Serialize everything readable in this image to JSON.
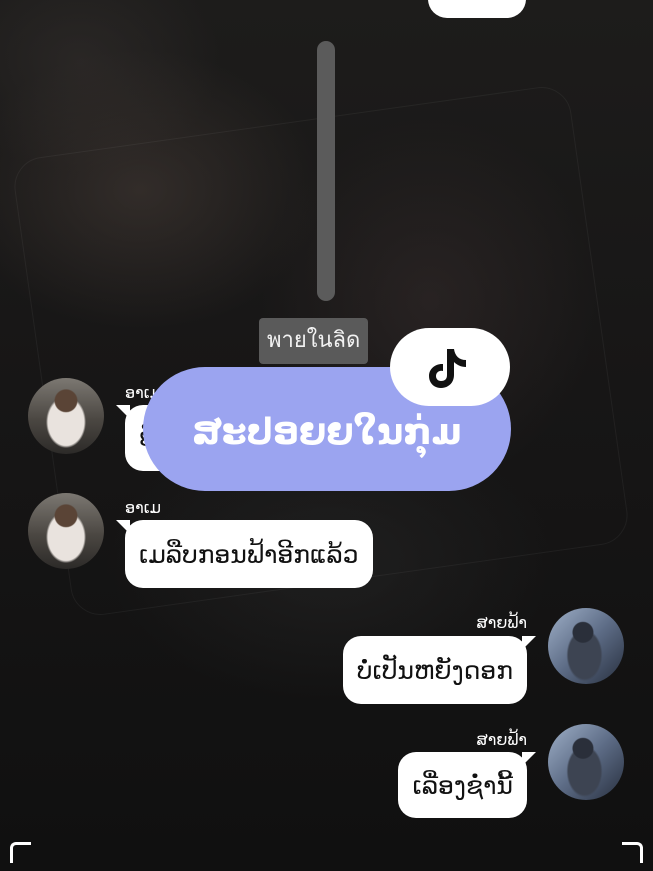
{
  "divider": {
    "label": "พายในลิด"
  },
  "overlay": {
    "title": "ສະປອຍຍໃນກຸ່ມ",
    "logo": "tiktok-logo-icon"
  },
  "messages": [
    {
      "side": "left",
      "sender": "ອາເມ",
      "text": "ຍັ",
      "avatar": "girl-avatar"
    },
    {
      "side": "left",
      "sender": "ອາເມ",
      "text": "ເມລືບກອນຟ້າອີກແລ້ວ",
      "avatar": "girl-avatar"
    },
    {
      "side": "right",
      "sender": "ສາຍຟ້າ",
      "text": "ບໍ່ເປັນຫຍັງດອກ",
      "avatar": "guy-avatar"
    },
    {
      "side": "right",
      "sender": "ສາຍຟ້າ",
      "text": "ເລື່ອງຊໍ່ານີ້",
      "avatar": "guy-avatar"
    }
  ],
  "colors": {
    "overlay_pill": "#9ba4f0",
    "bubble": "#ffffff",
    "divider_bg": "#5a5a5a"
  }
}
